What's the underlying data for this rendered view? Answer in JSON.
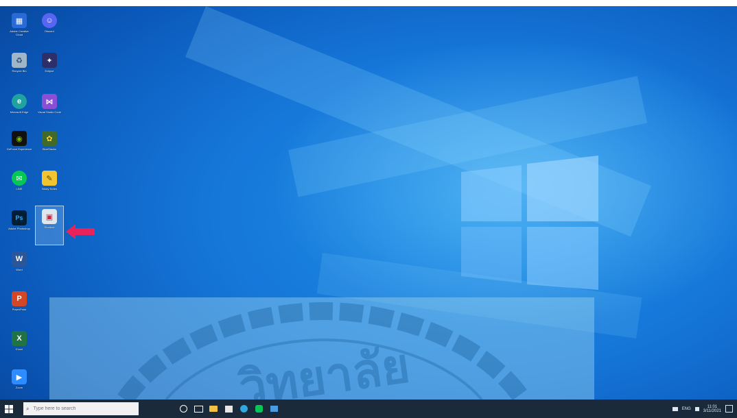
{
  "desktop": {
    "icons": [
      {
        "label": "Adobe Creative Cloud",
        "icon": "network-icon",
        "color": "#2a6ad6"
      },
      {
        "label": "Discord",
        "icon": "discord-icon",
        "color": "#5865f2"
      },
      {
        "label": "Recycle Bin",
        "icon": "recycle-bin-icon",
        "color": "#9fb6c9"
      },
      {
        "label": "Eclipse",
        "icon": "eclipse-icon",
        "color": "#2c2f6a"
      },
      {
        "label": "Microsoft Edge",
        "icon": "edge-icon",
        "color": "#1fa3a0"
      },
      {
        "label": "Visual Studio Code",
        "icon": "visual-studio-icon",
        "color": "#8b4fd6"
      },
      {
        "label": "GeForce Experience",
        "icon": "geforce-icon",
        "color": "#76b900"
      },
      {
        "label": "BlueStacks",
        "icon": "bluestacks-icon",
        "color": "#3f6a2a"
      },
      {
        "label": "LINE",
        "icon": "line-icon",
        "color": "#06c755"
      },
      {
        "label": "Sticky Notes",
        "icon": "sticky-notes-icon",
        "color": "#f2c430"
      },
      {
        "label": "Adobe Photoshop",
        "icon": "photoshop-icon",
        "color": "#001e36"
      },
      {
        "label": "Shortcut",
        "icon": "app-shortcut-icon",
        "color": "#e0e6ee"
      },
      {
        "label": "Word",
        "icon": "word-icon",
        "color": "#2b579a"
      },
      {
        "label": "PowerPoint",
        "icon": "powerpoint-icon",
        "color": "#d24726"
      },
      {
        "label": "Excel",
        "icon": "excel-icon",
        "color": "#217346"
      },
      {
        "label": "Zoom",
        "icon": "zoom-icon",
        "color": "#2d8cff"
      }
    ]
  },
  "pointer_arrow": {
    "color": "#e8225a"
  },
  "watermark": {
    "text": "วิทยาลัย"
  },
  "taskbar": {
    "search_placeholder": "Type here to search",
    "pinned": [
      {
        "icon": "search-circle-icon"
      },
      {
        "icon": "task-view-icon"
      },
      {
        "icon": "file-explorer-icon"
      },
      {
        "icon": "store-icon"
      },
      {
        "icon": "edge-taskbar-icon"
      },
      {
        "icon": "line-taskbar-icon"
      },
      {
        "icon": "app-taskbar-icon"
      }
    ],
    "tray_text": "ENG",
    "clock_time": "11:01",
    "clock_date": "3/11/2021"
  },
  "colors": {
    "taskbar": "#1b2a3a",
    "wallpaper_accent": "#1576d8"
  }
}
